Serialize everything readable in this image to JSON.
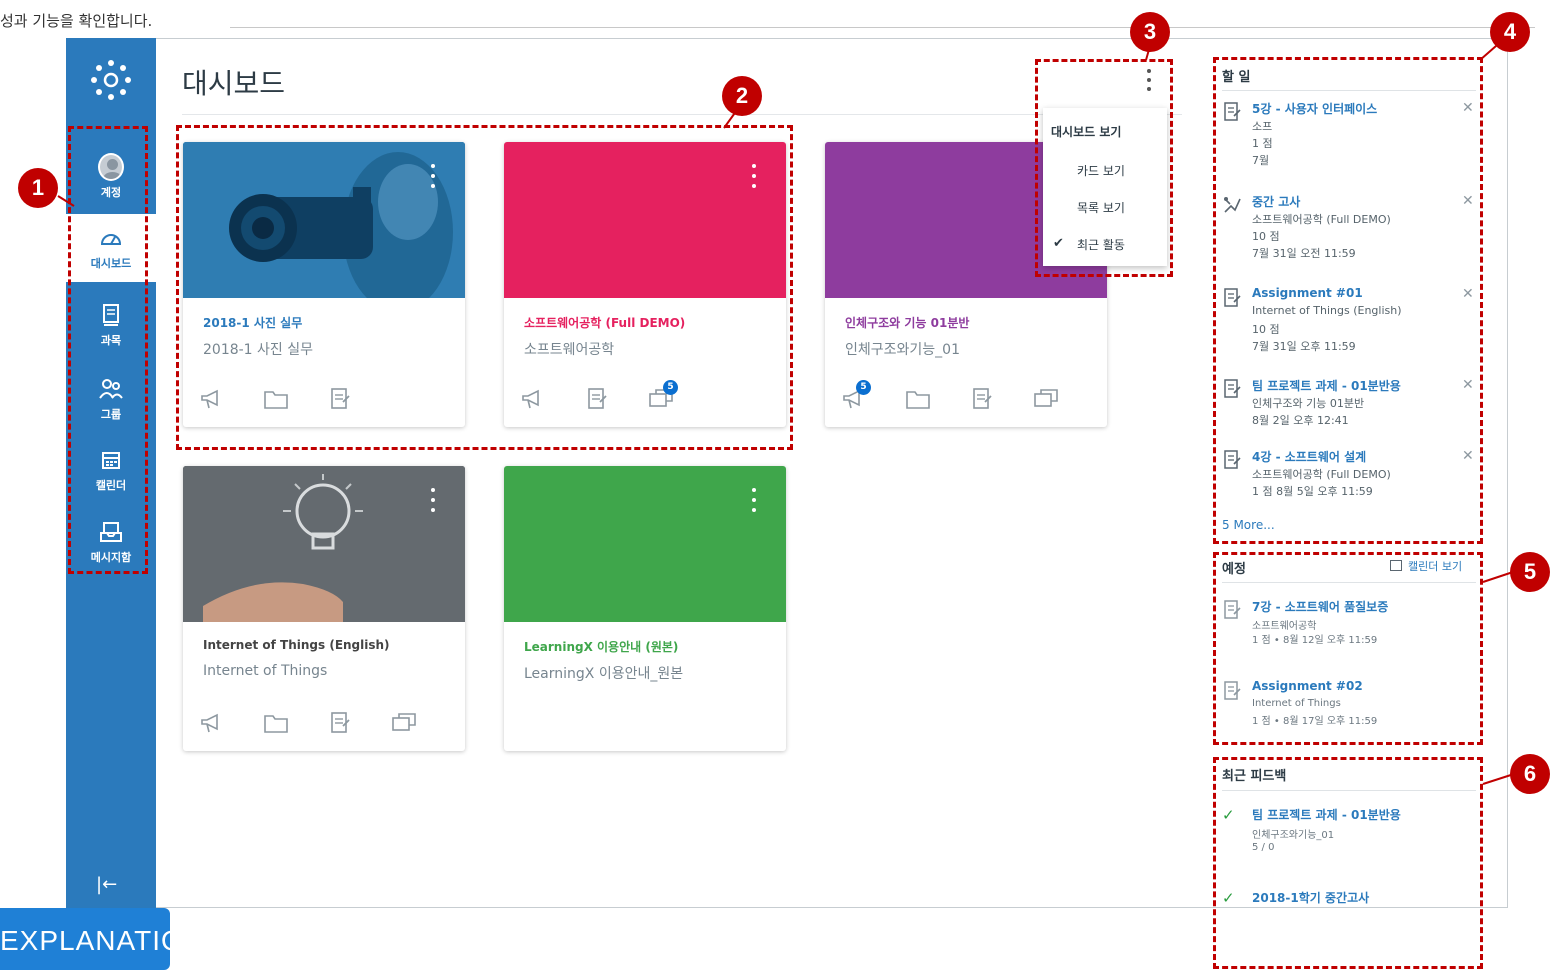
{
  "caption": "성과 기능을 확인합니다.",
  "nav": {
    "items": [
      {
        "label": "계정",
        "icon": "avatar"
      },
      {
        "label": "대시보드",
        "icon": "dashboard-icon"
      },
      {
        "label": "과목",
        "icon": "courses-icon"
      },
      {
        "label": "그룹",
        "icon": "groups-icon"
      },
      {
        "label": "캘린더",
        "icon": "calendar-icon"
      },
      {
        "label": "메시지함",
        "icon": "inbox-icon"
      }
    ],
    "collapse_glyph": "|←"
  },
  "page_title": "대시보드",
  "cards": [
    {
      "title": "2018-1 사진 실무",
      "subtitle": "2018-1 사진 실무",
      "color": "#1f70a8",
      "title_color": "#2b7abc",
      "actions": [
        "announcements-icon",
        "files-icon",
        "assignments-icon"
      ],
      "badges": {}
    },
    {
      "title": "소프트웨어공학 (Full DEMO)",
      "subtitle": "소프트웨어공학",
      "color": "#e5215f",
      "title_color": "#e5215f",
      "actions": [
        "announcements-icon",
        "assignments-icon",
        "discussions-icon"
      ],
      "badges": {
        "discussions-icon": "5"
      }
    },
    {
      "title": "인체구조와 기능 01분반",
      "subtitle": "인체구조와기능_01",
      "color": "#8e3c9e",
      "title_color": "#8e3c9e",
      "actions": [
        "announcements-icon",
        "files-icon",
        "assignments-icon",
        "discussions-icon"
      ],
      "badges": {
        "announcements-icon": "5"
      }
    },
    {
      "title": "Internet of Things (English)",
      "subtitle": "Internet of Things",
      "color": "#5d6468",
      "title_color": "#444",
      "actions": [
        "announcements-icon",
        "files-icon",
        "assignments-icon",
        "discussions-icon"
      ],
      "badges": {}
    },
    {
      "title": "LearningX 이용안내 (원본)",
      "subtitle": "LearningX 이용안내_원본",
      "color": "#3fa64b",
      "title_color": "#3fa64b",
      "actions": [],
      "badges": {}
    }
  ],
  "menu": {
    "heading": "대시보드 보기",
    "items": [
      "카드 보기",
      "목록 보기",
      "최근 활동"
    ],
    "checked_index": 2
  },
  "todo": {
    "heading": "할 일",
    "items": [
      {
        "title": "5강 - 사용자 인터페이스",
        "l1": "소프",
        "l2": "1 점",
        "l3": "7월",
        "icon": "assignment-icon"
      },
      {
        "title": "중간 고사",
        "l1": "소프트웨어공학 (Full DEMO)",
        "l2": "10 점",
        "l3": "7월 31일 오전 11:59",
        "icon": "quiz-icon"
      },
      {
        "title": "Assignment #01",
        "l1": "Internet of Things (English)",
        "l2": "10 점",
        "l3": "7월 31일 오후 11:59",
        "icon": "assignment-icon"
      },
      {
        "title": "팀 프로젝트 과제 - 01분반용",
        "l1": "인체구조와 기능 01분반",
        "l2": "8월 2일 오후 12:41",
        "l3": "",
        "icon": "assignment-icon"
      },
      {
        "title": "4강 - 소프트웨어 설계",
        "l1": "소프트웨어공학 (Full DEMO)",
        "l2": "1 점    8월 5일 오후 11:59",
        "l3": "",
        "icon": "assignment-icon"
      }
    ],
    "more": "5 More..."
  },
  "upcoming": {
    "heading": "예정",
    "calendar_link": "캘린더 보기",
    "items": [
      {
        "title": "7강 - 소프트웨어 품질보증",
        "l1": "소프트웨어공학",
        "l2": "1 점 • 8월 12일 오후 11:59"
      },
      {
        "title": "Assignment #02",
        "l1": "Internet of Things",
        "l2": "1 점 • 8월 17일 오후 11:59"
      }
    ]
  },
  "feedback": {
    "heading": "최근 피드백",
    "items": [
      {
        "title": "팀 프로젝트 과제 - 01분반용",
        "l1": "인체구조와기능_01",
        "l2": "5 / 0"
      },
      {
        "title": "2018-1학기 중간고사",
        "l1": "",
        "l2": ""
      }
    ]
  },
  "markers": [
    "1",
    "2",
    "3",
    "4",
    "5",
    "6"
  ],
  "explain_label": "EXPLANATION",
  "colors": {
    "nav": "#2b7abc",
    "annotation": "#c00000",
    "link": "#2b7abc"
  }
}
